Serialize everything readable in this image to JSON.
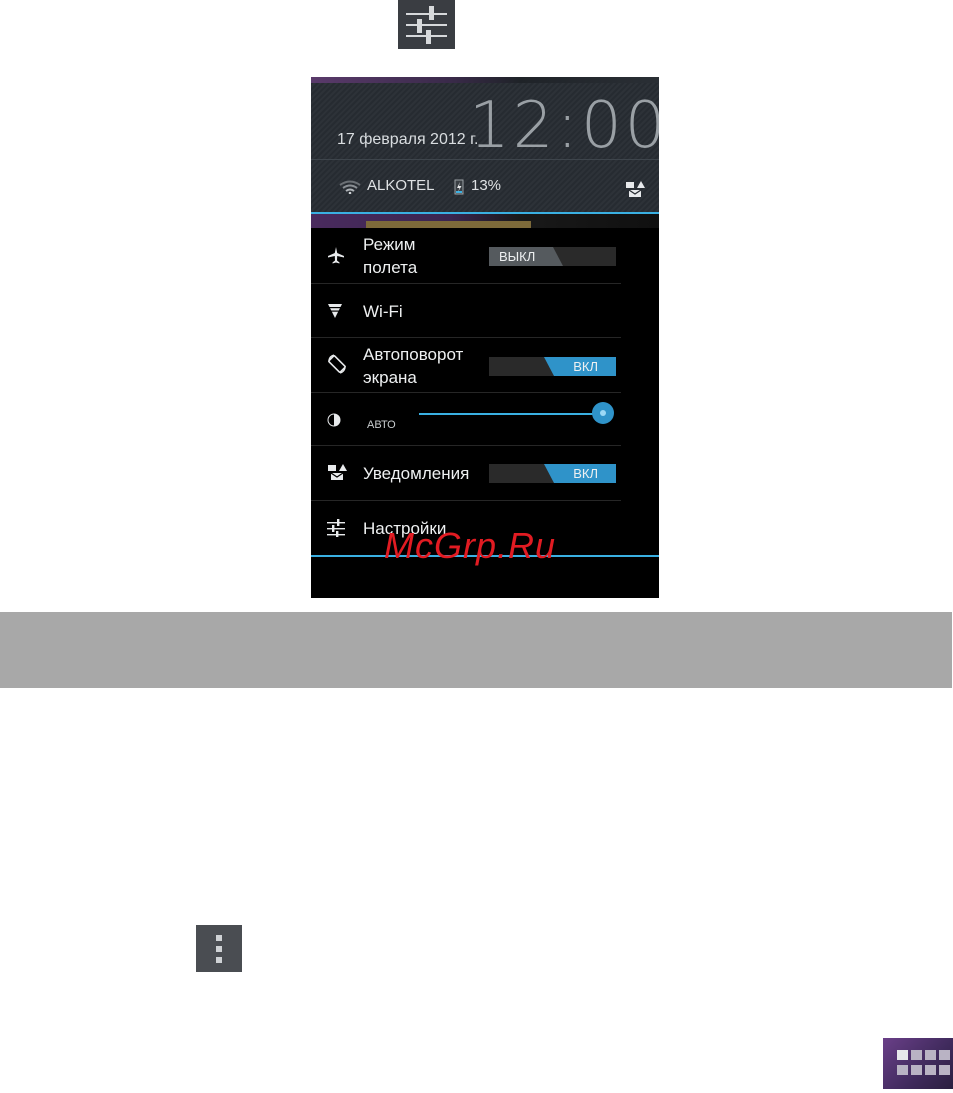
{
  "header": {
    "date": "17 февраля 2012 г.",
    "time": "12:00",
    "carrier": "ALKOTEL",
    "battery": "13%"
  },
  "quick_settings": {
    "airplane": {
      "label_line1": "Режим",
      "label_line2": "полета",
      "toggle_state": "ВЫКЛ"
    },
    "wifi": {
      "label": "Wi-Fi"
    },
    "autorotate": {
      "label_line1": "Автоповорот",
      "label_line2": "экрана",
      "toggle_state": "ВКЛ"
    },
    "brightness": {
      "auto_label": "АВТО",
      "level": 1.0
    },
    "notifications": {
      "label": "Уведомления",
      "toggle_state": "ВКЛ"
    },
    "settings": {
      "label": "Настройки"
    }
  },
  "watermark": "McGrp.Ru",
  "colors": {
    "accent": "#3ab0e2",
    "toggle_on": "#2f93c9",
    "watermark": "#e11b22",
    "band": "#a8a8a8"
  },
  "icons": [
    "settings-sliders-icon",
    "menu-dots-icon",
    "apps-grid-icon"
  ]
}
